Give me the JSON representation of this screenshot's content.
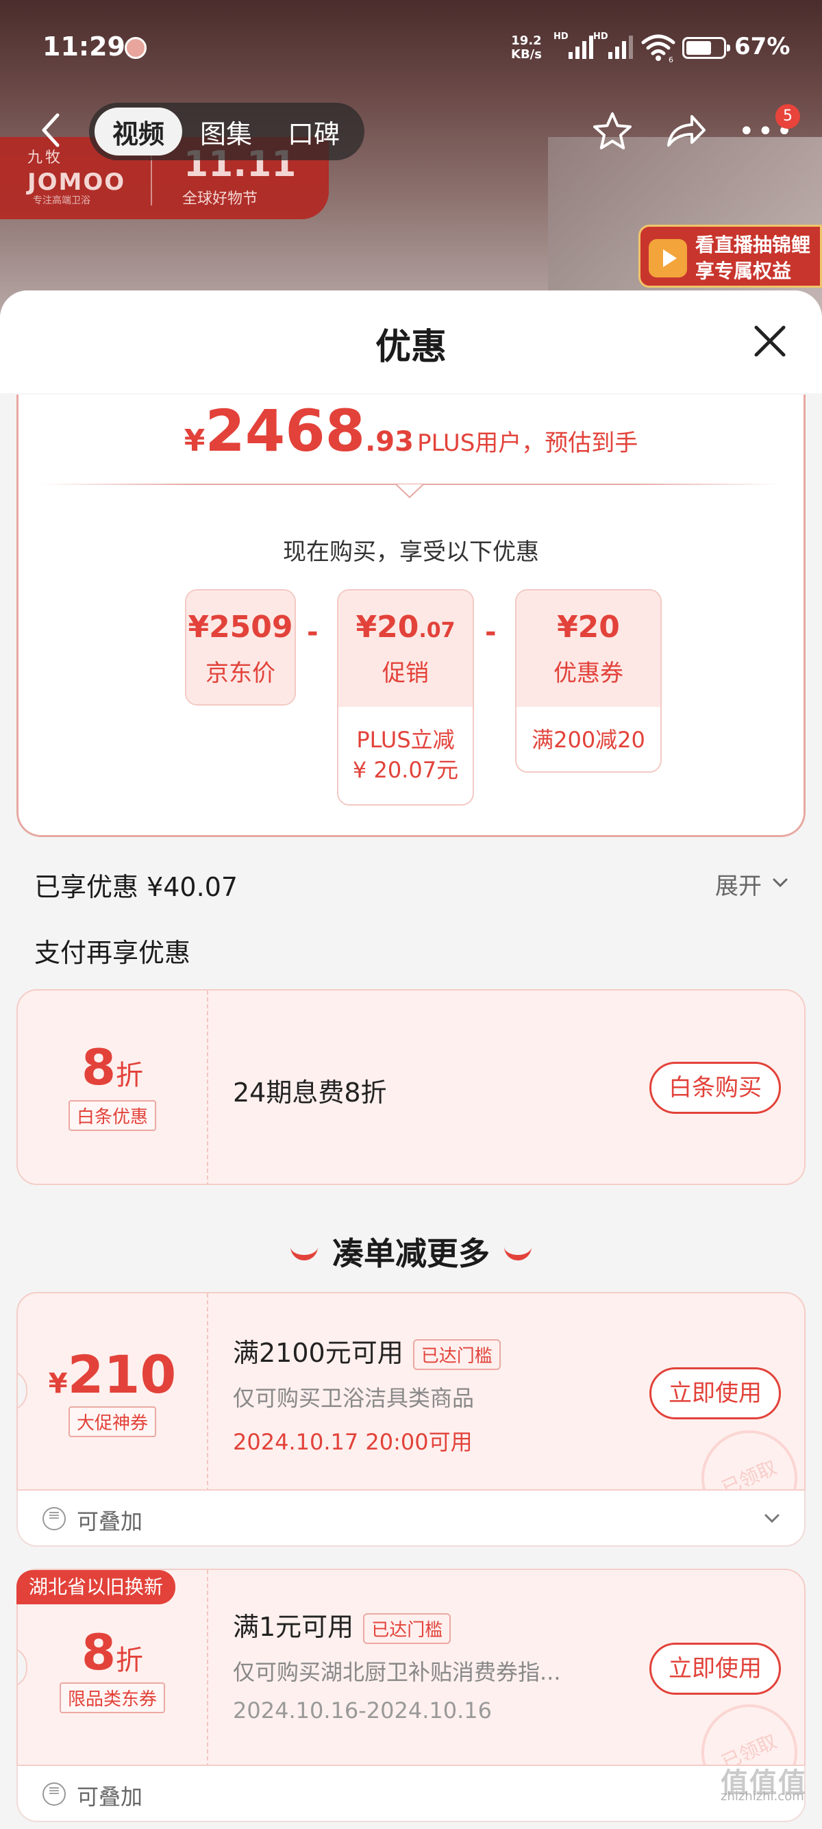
{
  "status_bar": {
    "time": "11:29",
    "net_speed_value": "19.2",
    "net_speed_unit": "KB/s",
    "hd_label": "HD",
    "wifi_sub": "6",
    "battery_pct": "67%"
  },
  "nav": {
    "tabs": [
      "视频",
      "图集",
      "口碑"
    ],
    "active_tab": 0,
    "more_badge": "5"
  },
  "background": {
    "brand_cn": "九牧",
    "brand_en": "JOMOO",
    "brand_tagline": "专注高端卫浴",
    "event": "11.11",
    "event_sub": "全球好物节",
    "live_line1": "看直播抽锦鲤",
    "live_line2": "享专属权益"
  },
  "sheet": {
    "title": "优惠"
  },
  "price": {
    "yen": "¥",
    "integer": "2468",
    "decimal": ".93",
    "label": "PLUS用户，预估到手",
    "buy_now_text": "现在购买，享受以下优惠"
  },
  "breakdown": [
    {
      "value_main": "¥2509",
      "value_small": "",
      "name": "京东价",
      "detail": ""
    },
    {
      "value_main": "¥20",
      "value_small": ".07",
      "name": "促销",
      "detail_line1": "PLUS立减",
      "detail_line2": "¥ 20.07元"
    },
    {
      "value_main": "¥20",
      "value_small": "",
      "name": "优惠券",
      "detail_line1": "满200减20",
      "detail_line2": ""
    }
  ],
  "minus_sign": "-",
  "enjoyed": {
    "label": "已享优惠 ¥40.07",
    "expand": "展开"
  },
  "pay_section": {
    "title": "支付再享优惠",
    "card": {
      "amount": "8",
      "unit": "折",
      "tag": "白条优惠",
      "text": "24期息费8折",
      "button": "白条购买"
    }
  },
  "more_section": {
    "title": "凑单减更多"
  },
  "coupons": [
    {
      "currency": "¥",
      "amount": "210",
      "tag": "大促神券",
      "title": "满2100元可用",
      "reached": "已达门槛",
      "desc": "仅可购买卫浴洁具类商品",
      "date": "2024.10.17 20:00可用",
      "button": "立即使用",
      "stamp": "已领取",
      "stackable": "可叠加"
    },
    {
      "badge": "湖北省以旧换新",
      "amount": "8",
      "unit": "折",
      "tag": "限品类东券",
      "title": "满1元可用",
      "reached": "已达门槛",
      "desc": "仅可购买湖北厨卫补贴消费券指...",
      "date": "2024.10.16-2024.10.16",
      "button": "立即使用",
      "stamp": "已领取",
      "stackable": "可叠加"
    }
  ],
  "watermark": {
    "logo": "值值值",
    "url": "zhizhizhi.com"
  },
  "colors": {
    "accent": "#e2423a",
    "card_bg": "#fef0ee",
    "border": "#f5cdc8"
  }
}
